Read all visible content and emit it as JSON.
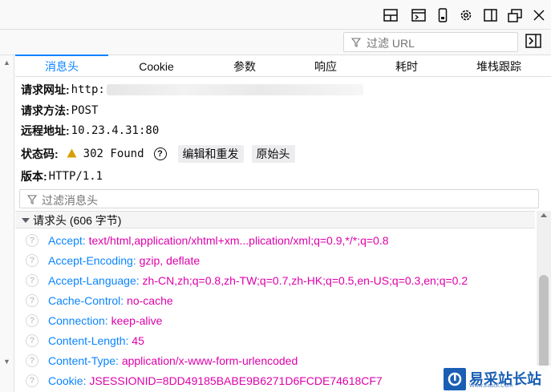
{
  "toolbar": {
    "icons": [
      "layout-icon",
      "console-icon",
      "responsive-icon",
      "settings-icon",
      "dock-side-icon",
      "popout-icon",
      "close-icon"
    ]
  },
  "filter_url": {
    "placeholder": "过滤 URL"
  },
  "tabs": [
    {
      "label": "消息头",
      "active": true
    },
    {
      "label": "Cookie",
      "active": false
    },
    {
      "label": "参数",
      "active": false
    },
    {
      "label": "响应",
      "active": false
    },
    {
      "label": "耗时",
      "active": false
    },
    {
      "label": "堆栈跟踪",
      "active": false
    }
  ],
  "summary": {
    "url_label": "请求网址:",
    "url_value": "http:",
    "method_label": "请求方法:",
    "method_value": "POST",
    "remote_label": "远程地址:",
    "remote_value": "10.23.4.31:80",
    "status_label": "状态码:",
    "status_value": "302 Found",
    "edit_resend": "编辑和重发",
    "raw_headers": "原始头",
    "version_label": "版本:",
    "version_value": "HTTP/1.1"
  },
  "headers_filter": {
    "placeholder": "过滤消息头"
  },
  "request_headers": {
    "title": "请求头 (606 字节)",
    "rows": [
      {
        "name": "Accept:",
        "value": "text/html,application/xhtml+xm...plication/xml;q=0.9,*/*;q=0.8"
      },
      {
        "name": "Accept-Encoding:",
        "value": "gzip, deflate"
      },
      {
        "name": "Accept-Language:",
        "value": "zh-CN,zh;q=0.8,zh-TW;q=0.7,zh-HK;q=0.5,en-US;q=0.3,en;q=0.2"
      },
      {
        "name": "Cache-Control:",
        "value": "no-cache"
      },
      {
        "name": "Connection:",
        "value": "keep-alive"
      },
      {
        "name": "Content-Length:",
        "value": "45"
      },
      {
        "name": "Content-Type:",
        "value": "application/x-www-form-urlencoded"
      },
      {
        "name": "Cookie:",
        "value": "JSESSIONID=8DD49185BABE9B6271D6FCDE74618CF7"
      }
    ]
  },
  "watermark": {
    "text": "易采站长站",
    "sub": "Www.Easck.Com"
  },
  "colors": {
    "accent": "#0a84ff",
    "header_value": "#dd00a9",
    "warning": "#d7a000"
  }
}
